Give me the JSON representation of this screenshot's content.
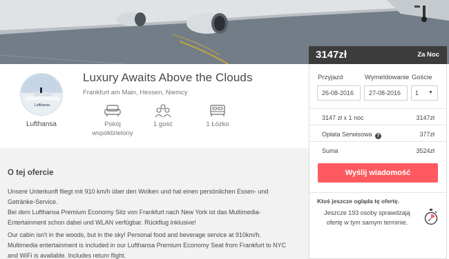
{
  "listing": {
    "title": "Luxury Awaits Above the Clouds",
    "location": "Frankfurt am Main, Hessen, Niemcy",
    "host_name": "Lufthansa",
    "amenities": [
      {
        "icon": "sofa-icon",
        "label": "Pokój\nwspółdzielony"
      },
      {
        "icon": "guests-icon",
        "label": "1 gość"
      },
      {
        "icon": "bed-icon",
        "label": "1 Łóżko"
      }
    ]
  },
  "about": {
    "title": "O tej ofercie",
    "paragraphs": [
      "Unsere Unterkunft fliegt mit 910 km/h über den Wolken und hat einen persönlichen Essen- und Getränke-Service.\nBei dem Lufthansa Premium Economy Sitz von Frankfurt nach New York ist das Multimedia-Entertainment schon dabei und WLAN verfügbar. Rückflug inklusive!",
      "Our cabin isn't in the woods, but in the sky! Personal food and beverage service at 910km/h.\nMultimedia entertainment is included in our Lufthansa Premium Economy Seat from Frankfurt to NYC and WiFi is available. Includes return flight."
    ]
  },
  "booking": {
    "price": "3147zł",
    "per": "Za Noc",
    "checkin_label": "Przyjazd",
    "checkout_label": "Wymeldowanie",
    "guests_label": "Goście",
    "checkin_value": "26-08-2016",
    "checkout_value": "27-08-2016",
    "guests_value": "1",
    "rows": [
      {
        "label": "3147 zł x 1 noc",
        "value": "3147zł"
      },
      {
        "label": "Opłata Serwisowa",
        "value": "377zł"
      },
      {
        "label": "Suma",
        "value": "3524zł"
      }
    ],
    "send_button": "Wyślij wiadomość",
    "watch_title": "Ktoś jeszcze ogląda tę ofertę.",
    "watch_text": "Jeszcze 193 osoby sprawdzają ofertę w tym samym terminie."
  },
  "colors": {
    "accent": "#ff5a5f",
    "price_bar": "#3c3c3c"
  }
}
